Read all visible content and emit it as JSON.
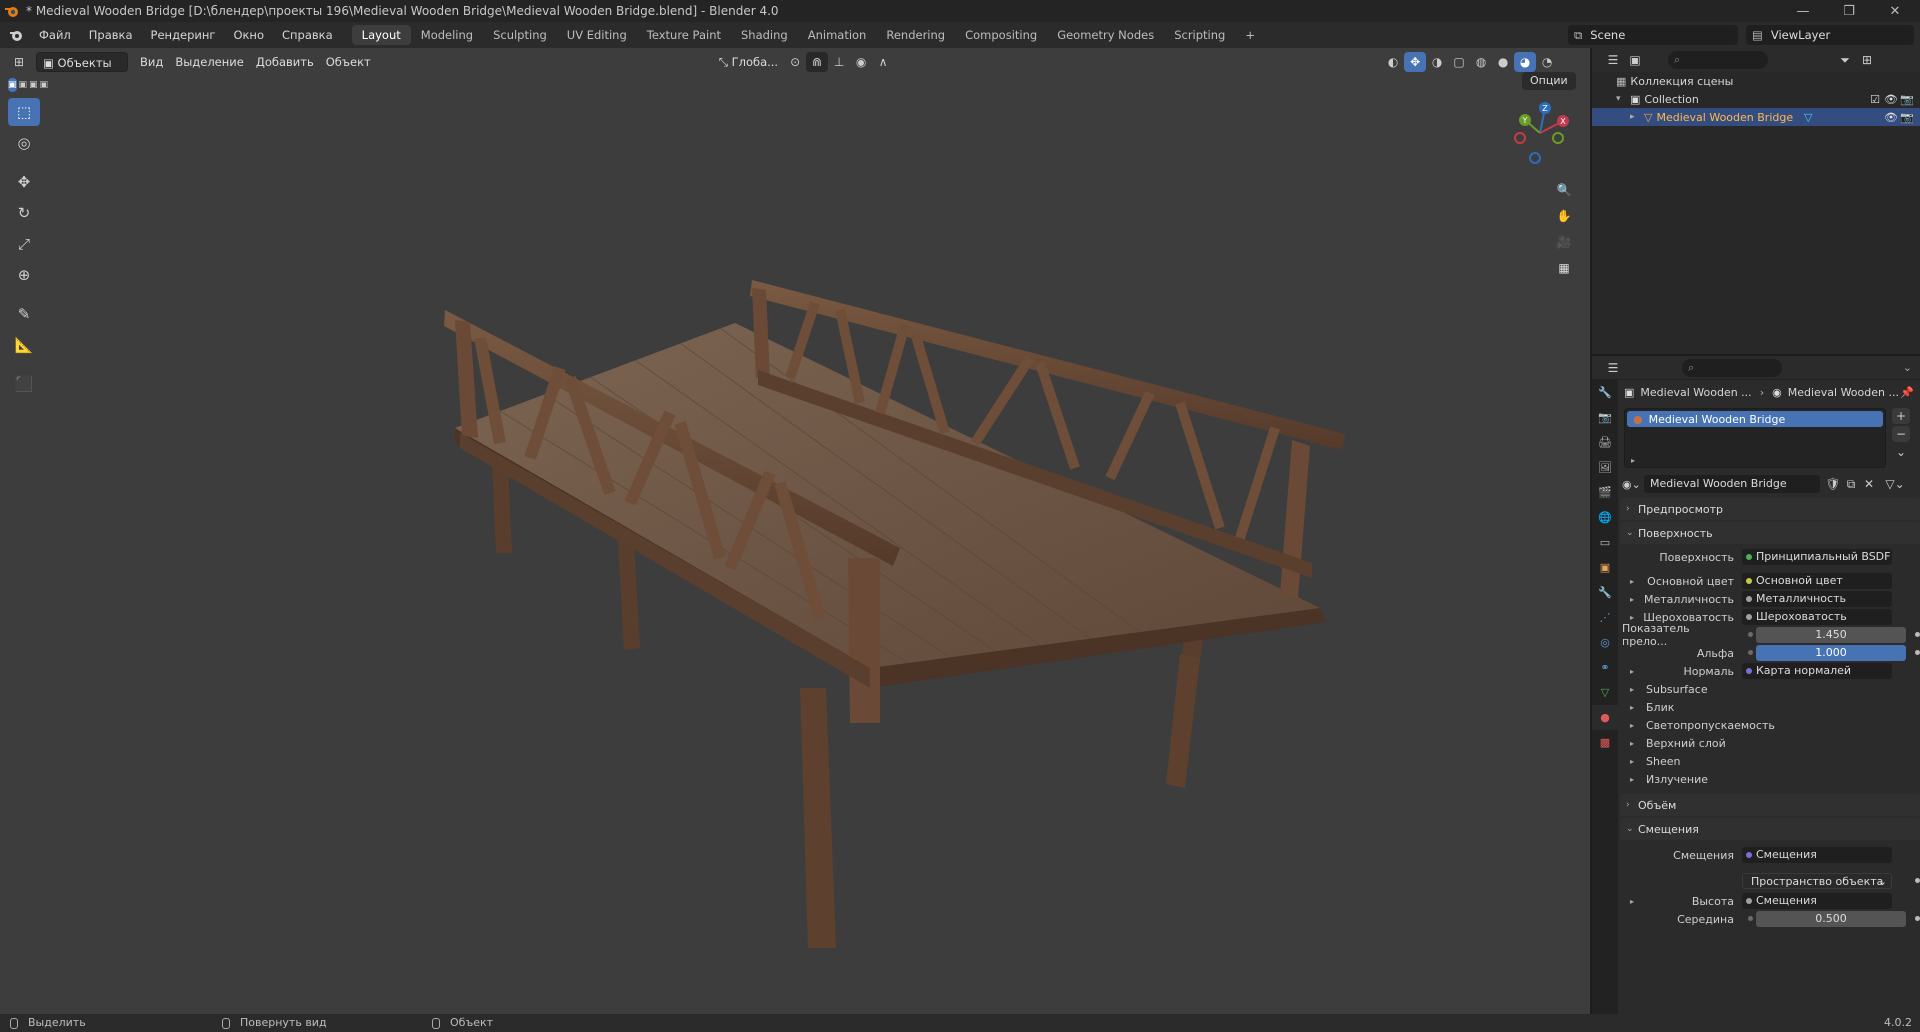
{
  "title_bar": {
    "text": "* Medieval Wooden Bridge [D:\\блендер\\проекты 196\\Medieval Wooden Bridge\\Medieval Wooden Bridge.blend] - Blender 4.0",
    "min": "—",
    "max": "❐",
    "close": "✕"
  },
  "menu": [
    "Файл",
    "Правка",
    "Рендеринг",
    "Окно",
    "Справка"
  ],
  "workspaces": [
    "Layout",
    "Modeling",
    "Sculpting",
    "UV Editing",
    "Texture Paint",
    "Shading",
    "Animation",
    "Rendering",
    "Compositing",
    "Geometry Nodes",
    "Scripting",
    "+"
  ],
  "active_workspace": "Layout",
  "scene": "Scene",
  "view_layer": "ViewLayer",
  "viewport_header": {
    "mode": "Объекты",
    "menus": [
      "Вид",
      "Выделение",
      "Добавить",
      "Объект"
    ],
    "transform_orientation": "Глоба...",
    "options": "Опции"
  },
  "gizmo": {
    "z": "Z",
    "y": "Y",
    "x": "X"
  },
  "outliner": {
    "root": "Коллекция сцены",
    "collection": "Collection",
    "object": "Medieval Wooden Bridge"
  },
  "properties": {
    "breadcrumb_object": "Medieval Wooden ...",
    "breadcrumb_material": "Medieval Wooden ...",
    "slot": "Medieval Wooden Bridge",
    "material_name": "Medieval Wooden Bridge",
    "panels": {
      "preview": "Предпросмотр",
      "surface": "Поверхность",
      "volume": "Объём",
      "displacement": "Смещения"
    },
    "surface_rows": [
      {
        "label": "Поверхность",
        "value": "Принципиальный BSDF",
        "dot": "#4caf50",
        "arrow": false
      },
      {
        "label": "Основной цвет",
        "value": "Основной цвет",
        "dot": "#c8c83c",
        "arrow": true
      },
      {
        "label": "Металличность",
        "value": "Металличность",
        "dot": "#a0a0a0",
        "arrow": true
      },
      {
        "label": "Шероховатость",
        "value": "Шероховатость",
        "dot": "#a0a0a0",
        "arrow": true
      }
    ],
    "ior_label": "Показатель прело...",
    "ior_value": "1.450",
    "alpha_label": "Альфа",
    "alpha_value": "1.000",
    "normal_label": "Нормаль",
    "normal_value": "Карта нормалей",
    "subpanels": [
      "Subsurface",
      "Блик",
      "Светопропускаемость",
      "Верхний слой",
      "Sheen",
      "Излучение"
    ],
    "disp_label": "Смещения",
    "disp_value": "Смещения",
    "space_value": "Пространство объекта",
    "height_label": "Высота",
    "height_value": "Смещения",
    "midlevel_label": "Середина",
    "midlevel_value": "0.500"
  },
  "status_bar": {
    "select": "Выделить",
    "rotate": "Повернуть вид",
    "object": "Объект",
    "version": "4.0.2"
  }
}
